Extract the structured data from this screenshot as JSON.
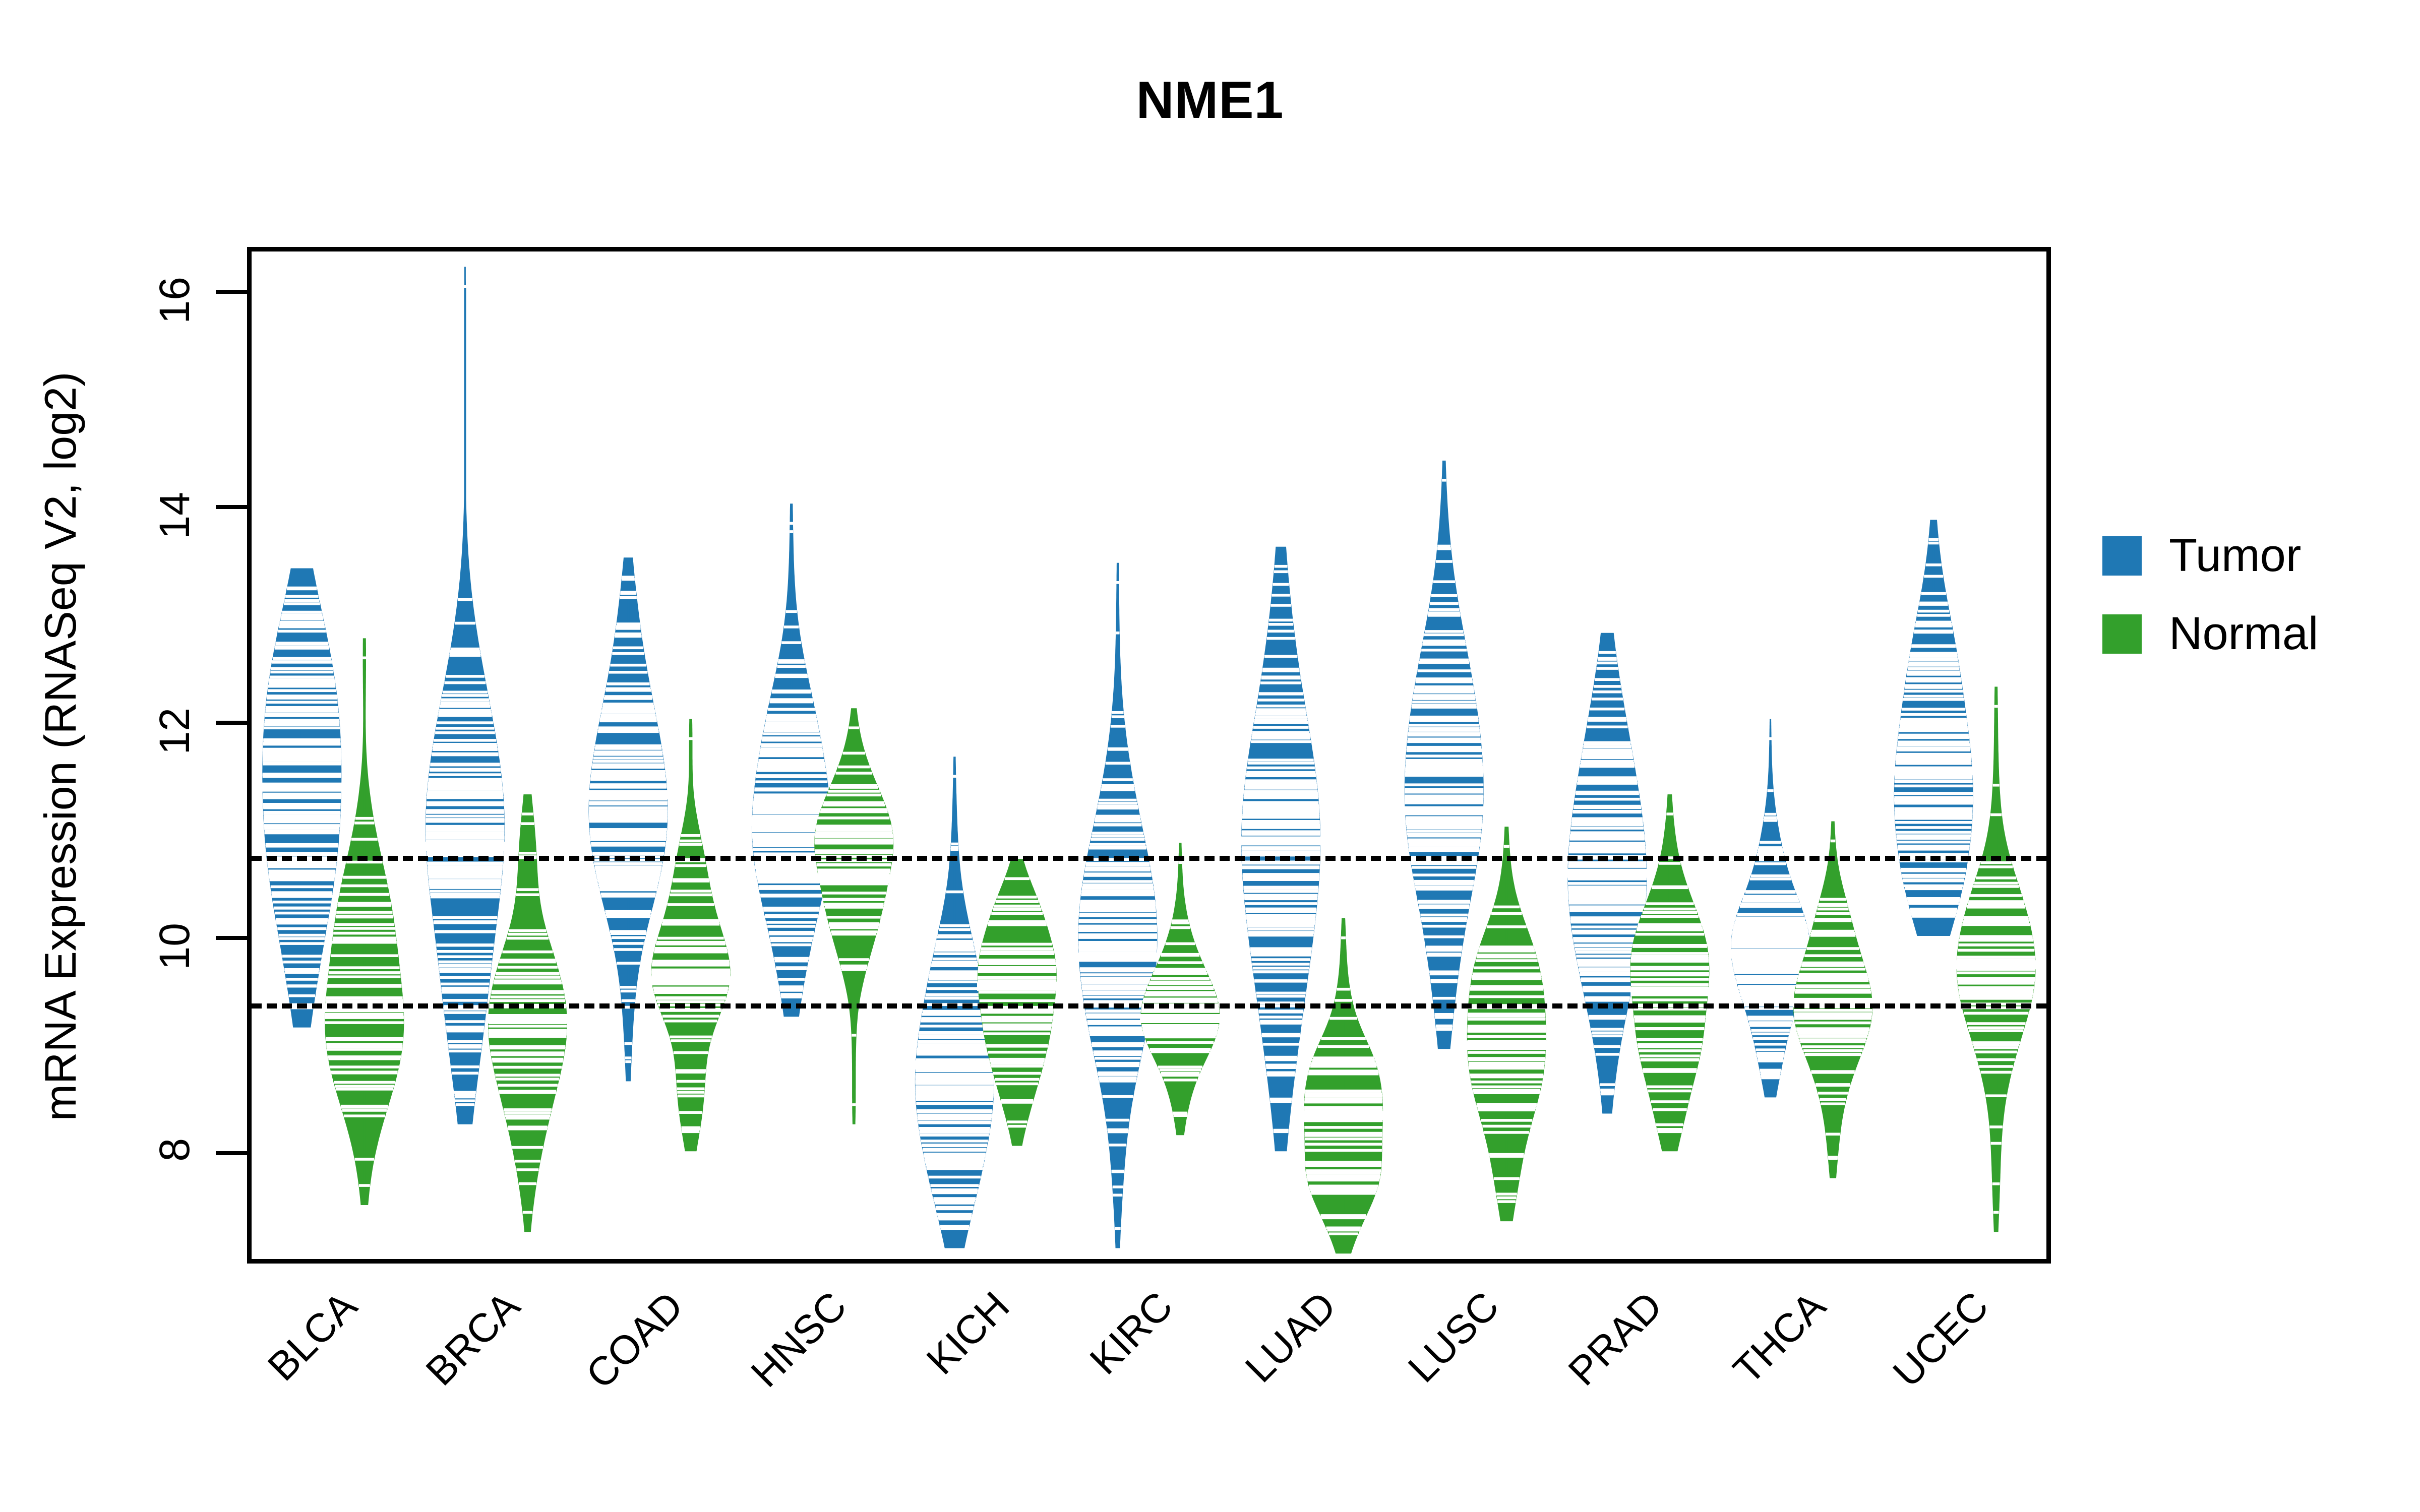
{
  "title": "NME1",
  "axis": {
    "ylabel": "mRNA Expression (RNASeq V2, log2)",
    "yticks": [
      "8",
      "10",
      "12",
      "14",
      "16"
    ]
  },
  "legend": {
    "items": [
      {
        "label": "Tumor",
        "color": "#1f78b4"
      },
      {
        "label": "Normal",
        "color": "#33a02c"
      }
    ]
  },
  "chart_data": {
    "type": "violin",
    "title": "NME1",
    "xlabel": "",
    "ylabel": "mRNA Expression (RNASeq V2, log2)",
    "ylim": [
      7.0,
      16.4
    ],
    "ytick_values": [
      8,
      10,
      12,
      14,
      16
    ],
    "grid": false,
    "legend_position": "right",
    "reference_lines": [
      10.76,
      9.39
    ],
    "reference_line_style": "dotted",
    "categories": [
      "BLCA",
      "BRCA",
      "COAD",
      "HNSC",
      "KICH",
      "KIRC",
      "LUAD",
      "LUSC",
      "PRAD",
      "THCA",
      "UCEC"
    ],
    "series": [
      {
        "name": "Tumor",
        "color": "#1f78b4",
        "medians": [
          11.4,
          10.85,
          11.33,
          11.08,
          8.82,
          9.82,
          10.9,
          11.18,
          10.6,
          9.85,
          11.55
        ],
        "mins": [
          9.35,
          8.45,
          8.85,
          9.45,
          7.3,
          7.3,
          8.2,
          9.15,
          8.55,
          8.7,
          10.2
        ],
        "maxs": [
          13.25,
          16.05,
          13.35,
          13.85,
          11.5,
          13.3,
          13.45,
          14.25,
          12.65,
          11.85,
          13.7
        ],
        "q1": [
          10.55,
          9.75,
          10.55,
          10.25,
          8.1,
          9.1,
          9.7,
          10.35,
          9.65,
          9.35,
          10.85
        ],
        "q3": [
          12.35,
          11.85,
          12.1,
          11.85,
          9.55,
          10.75,
          11.9,
          12.15,
          11.45,
          10.35,
          12.35
        ]
      },
      {
        "name": "Normal",
        "color": "#33a02c",
        "medians": [
          9.35,
          9.25,
          9.6,
          10.55,
          9.55,
          9.25,
          8.35,
          9.0,
          9.5,
          9.4,
          9.75
        ],
        "mins": [
          7.7,
          7.45,
          8.2,
          8.45,
          8.25,
          8.35,
          7.25,
          7.55,
          8.2,
          7.95,
          7.45
        ],
        "maxs": [
          12.6,
          11.15,
          11.85,
          11.95,
          10.55,
          10.7,
          10.0,
          10.85,
          11.15,
          10.9,
          12.15
        ],
        "q1": [
          8.85,
          8.65,
          9.1,
          10.05,
          9.1,
          8.8,
          7.95,
          8.5,
          9.05,
          8.95,
          9.15
        ],
        "q3": [
          10.25,
          9.8,
          10.1,
          11.0,
          10.0,
          9.7,
          8.8,
          9.6,
          10.05,
          9.9,
          10.35
        ]
      }
    ]
  }
}
